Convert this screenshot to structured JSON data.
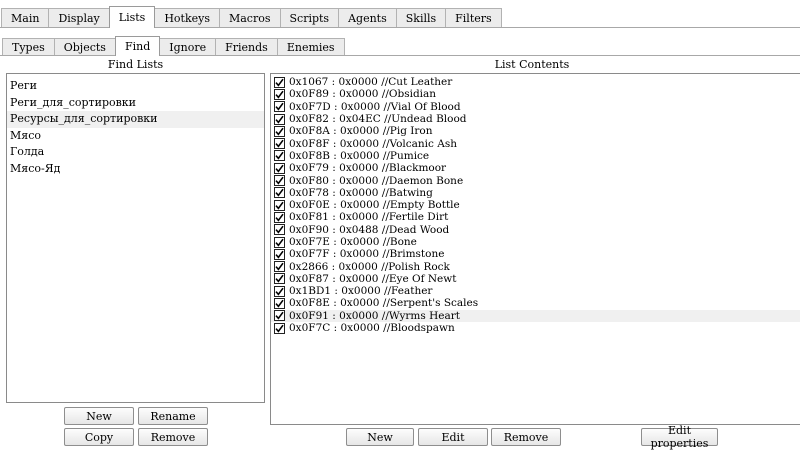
{
  "main_tabs": [
    "Main",
    "Display",
    "Lists",
    "Hotkeys",
    "Macros",
    "Scripts",
    "Agents",
    "Skills",
    "Filters"
  ],
  "main_active": "Lists",
  "sub_tabs": [
    "Types",
    "Objects",
    "Find",
    "Ignore",
    "Friends",
    "Enemies"
  ],
  "sub_active": "Find",
  "find_lists": {
    "header": "Find Lists",
    "items": [
      "Реги",
      "Реги_для_сортировки",
      "Ресурсы_для_сортировки",
      "Мясо",
      "Голда",
      "Мясо-Яд"
    ],
    "selected_index": 2
  },
  "list_contents": {
    "header": "List Contents",
    "highlighted_index": 19,
    "items": [
      {
        "checked": true,
        "text": "0x1067 : 0x0000 //Cut Leather"
      },
      {
        "checked": true,
        "text": "0x0F89 : 0x0000 //Obsidian"
      },
      {
        "checked": true,
        "text": "0x0F7D : 0x0000 //Vial Of Blood"
      },
      {
        "checked": true,
        "text": "0x0F82 : 0x04EC //Undead Blood"
      },
      {
        "checked": true,
        "text": "0x0F8A : 0x0000 //Pig Iron"
      },
      {
        "checked": true,
        "text": "0x0F8F : 0x0000 //Volcanic Ash"
      },
      {
        "checked": true,
        "text": "0x0F8B : 0x0000 //Pumice"
      },
      {
        "checked": true,
        "text": "0x0F79 : 0x0000 //Blackmoor"
      },
      {
        "checked": true,
        "text": "0x0F80 : 0x0000 //Daemon Bone"
      },
      {
        "checked": true,
        "text": "0x0F78 : 0x0000 //Batwing"
      },
      {
        "checked": true,
        "text": "0x0F0E : 0x0000 //Empty Bottle"
      },
      {
        "checked": true,
        "text": "0x0F81 : 0x0000 //Fertile Dirt"
      },
      {
        "checked": true,
        "text": "0x0F90 : 0x0488 //Dead Wood"
      },
      {
        "checked": true,
        "text": "0x0F7E : 0x0000 //Bone"
      },
      {
        "checked": true,
        "text": "0x0F7F : 0x0000 //Brimstone"
      },
      {
        "checked": true,
        "text": "0x2866 : 0x0000 //Polish Rock"
      },
      {
        "checked": true,
        "text": "0x0F87 : 0x0000 //Eye Of Newt"
      },
      {
        "checked": true,
        "text": "0x1BD1 : 0x0000 //Feather"
      },
      {
        "checked": true,
        "text": "0x0F8E : 0x0000 //Serpent's Scales"
      },
      {
        "checked": true,
        "text": "0x0F91 : 0x0000 //Wyrms Heart"
      },
      {
        "checked": true,
        "text": "0x0F7C : 0x0000 //Bloodspawn"
      }
    ]
  },
  "find_buttons": {
    "new": "New",
    "rename": "Rename",
    "copy": "Copy",
    "remove": "Remove"
  },
  "content_buttons": {
    "new": "New",
    "edit": "Edit",
    "remove": "Remove",
    "edit_properties": "Edit properties"
  },
  "icons": {
    "checkbox": "checkmark-icon"
  }
}
